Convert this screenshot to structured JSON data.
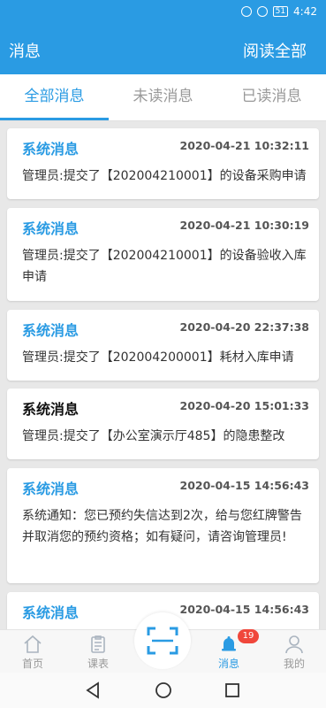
{
  "status_bar": {
    "battery": "51",
    "time": "4:42"
  },
  "header": {
    "title": "消息",
    "read_all": "阅读全部"
  },
  "tabs": [
    {
      "label": "全部消息",
      "active": true
    },
    {
      "label": "未读消息",
      "active": false
    },
    {
      "label": "已读消息",
      "active": false
    }
  ],
  "messages": [
    {
      "title": "系统消息",
      "time": "2020-04-21 10:32:11",
      "body": "管理员:提交了【202004210001】的设备采购申请",
      "read": false
    },
    {
      "title": "系统消息",
      "time": "2020-04-21 10:30:19",
      "body": "管理员:提交了【202004210001】的设备验收入库申请",
      "read": false
    },
    {
      "title": "系统消息",
      "time": "2020-04-20 22:37:38",
      "body": "管理员:提交了【202004200001】耗材入库申请",
      "read": false
    },
    {
      "title": "系统消息",
      "time": "2020-04-20 15:01:33",
      "body": "管理员:提交了【办公室演示厅485】的隐患整改",
      "read": true
    },
    {
      "title": "系统消息",
      "time": "2020-04-15 14:56:43",
      "body": "系统通知：您已预约失信达到2次，给与您红牌警告并取消您的预约资格；如有疑问，请咨询管理员!",
      "read": false
    },
    {
      "title": "系统消息",
      "time": "2020-04-15 14:56:43",
      "body": "",
      "read": false
    }
  ],
  "bottom_nav": {
    "home": "首页",
    "schedule": "课表",
    "messages": "消息",
    "mine": "我的",
    "badge": "19"
  },
  "colors": {
    "accent": "#2a9be3",
    "badge": "#f0473b"
  }
}
